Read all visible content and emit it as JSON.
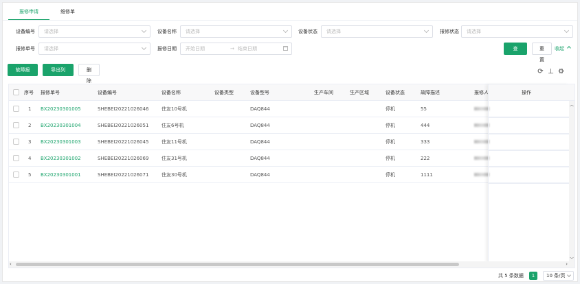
{
  "tabs": [
    {
      "label": "报修申请",
      "active": true
    },
    {
      "label": "维修单",
      "active": false
    }
  ],
  "filters": {
    "device_code": {
      "label": "设备编号",
      "placeholder": "请选择"
    },
    "device_name": {
      "label": "设备名称",
      "placeholder": "请选择"
    },
    "device_status": {
      "label": "设备状态",
      "placeholder": "请选择"
    },
    "repair_status": {
      "label": "报修状态",
      "placeholder": "请选择"
    },
    "repair_no": {
      "label": "报修单号",
      "placeholder": "请选择"
    },
    "repair_date": {
      "label": "报修日期",
      "start_placeholder": "开始日期",
      "end_placeholder": "结束日期",
      "separator": "→"
    }
  },
  "actions": {
    "query": "查 询",
    "reset": "重 置",
    "collapse": "收起"
  },
  "toolbar": {
    "report_fault": "故障报修",
    "export": "导出列表",
    "delete": "删 除"
  },
  "tool_icons": [
    "refresh-icon",
    "column-height-icon",
    "settings-icon"
  ],
  "table": {
    "columns": [
      "序号",
      "报修单号",
      "设备编号",
      "设备名称",
      "设备类型",
      "设备型号",
      "生产车间",
      "生产区域",
      "设备状态",
      "故障描述",
      "报修人",
      "操作"
    ],
    "rows": [
      {
        "idx": "1",
        "repair_no": "BX20230301005",
        "device_code": "SHEBEI20221026046",
        "device_name": "住友10号机",
        "device_type": "",
        "model": "DAQ844",
        "workshop": "",
        "area": "",
        "status": "停机",
        "desc": "55"
      },
      {
        "idx": "2",
        "repair_no": "BX20230301004",
        "device_code": "SHEBEI20221026051",
        "device_name": "住友6号机",
        "device_type": "",
        "model": "DAQ844",
        "workshop": "",
        "area": "",
        "status": "停机",
        "desc": "444"
      },
      {
        "idx": "3",
        "repair_no": "BX20230301003",
        "device_code": "SHEBEI20221026045",
        "device_name": "住友11号机",
        "device_type": "",
        "model": "DAQ844",
        "workshop": "",
        "area": "",
        "status": "停机",
        "desc": "333"
      },
      {
        "idx": "4",
        "repair_no": "BX20230301002",
        "device_code": "SHEBEI20221026069",
        "device_name": "住友31号机",
        "device_type": "",
        "model": "DAQ844",
        "workshop": "",
        "area": "",
        "status": "停机",
        "desc": "222"
      },
      {
        "idx": "5",
        "repair_no": "BX20230301001",
        "device_code": "SHEBEI20221026071",
        "device_name": "住友30号机",
        "device_type": "",
        "model": "DAQ844",
        "workshop": "",
        "area": "",
        "status": "停机",
        "desc": "1111"
      }
    ]
  },
  "pager": {
    "total": "共 5 条数据",
    "page": "1",
    "page_size": "10 条/页"
  },
  "colors": {
    "accent": "#1aa36b"
  }
}
